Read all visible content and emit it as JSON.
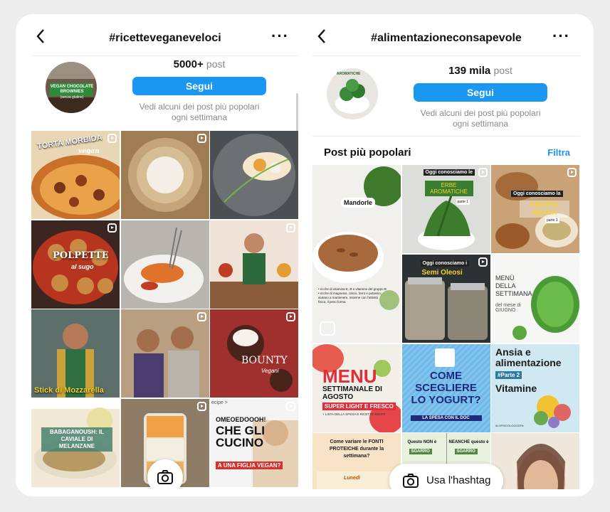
{
  "left": {
    "title": "#ricetteveganeveloci",
    "post_count": "5000+",
    "post_label": "post",
    "follow_label": "Segui",
    "hint_line1": "Vedi alcuni dei post più popolari",
    "hint_line2": "ogni settimana",
    "avatar_text1": "VEGAN CHOCOLATE BROWNIES",
    "avatar_text2": "(senza glutine)",
    "tiles": [
      {
        "caption": "TORTA MORBIDA",
        "caption2": "vegan"
      },
      {
        "caption": ""
      },
      {
        "caption": ""
      },
      {
        "caption": "POLPETTE",
        "caption2": "al sugo"
      },
      {
        "caption": ""
      },
      {
        "caption": ""
      },
      {
        "caption": "Stick di Mozzarella"
      },
      {
        "caption": ""
      },
      {
        "caption": "BOUNTY",
        "caption2": "Vegani"
      },
      {
        "caption": "BABAGANOUSH: IL CAVIALE DI MELANZANE"
      },
      {
        "caption": ""
      },
      {
        "caption": "OMEOEDOOOH!",
        "caption2": "CHE GLI CUCINO",
        "caption3": "A UNA FIGLIA VEGAN?",
        "top": "ecipe >"
      }
    ]
  },
  "right": {
    "title": "#alimentazioneconsapevole",
    "post_count": "139 mila",
    "post_label": "post",
    "follow_label": "Segui",
    "hint_line1": "Vedi alcuni dei post più popolari",
    "hint_line2": "ogni settimana",
    "section_title": "Post più popolari",
    "filter_label": "Filtra",
    "hashtag_button": "Usa l'hashtag",
    "tiles": [
      {
        "caption": "Mandorle",
        "small": "• ricche di vitamina E, B e vitamine del gruppo B • ricche di magnesio, calcio, ferro e potassio; aiutano a mantenere, insieme con l'attività fisica, il peso forma"
      },
      {
        "caption": "Oggi conosciamo le",
        "caption2": "ERBE AROMATICHE",
        "tag": "parte 1"
      },
      {
        "caption": "Oggi conosciamo la",
        "caption2": "FRUTTA SECCA",
        "tag": "parte 1"
      },
      {
        "caption": "Oggi conosciamo i",
        "caption2": "Semi Oleosi"
      },
      {
        "caption": "MENÙ DELLA SETTIMANA",
        "caption2": "del mese di GIUGNO"
      },
      {
        "caption": "MENU",
        "caption2": "SETTIMANALE DI AGOSTO",
        "caption3": "SUPER LIGHT E FRESCO",
        "caption4": "+ LISTA DELLA SPESA E RICETTE SMART"
      },
      {
        "caption": "COME SCEGLIERE LO YOGURT?",
        "caption2": "LA SPESA CON IL DOC"
      },
      {
        "caption": "Ansia e alimentazione",
        "caption2": "#Parte 2",
        "caption3": "Vitamine",
        "caption4": "#LOPSICOLOGOZEN"
      },
      {
        "caption": "Come variare le FONTI PROTEICHE durante la settimana?",
        "caption2": "Lunedì"
      },
      {
        "caption": "Questo NON è",
        "caption2": "SGARRO",
        "caption3": "NEANCHE questo è",
        "caption4": "SGARRO"
      },
      {
        "caption": ""
      }
    ]
  },
  "colors": {
    "accent": "#1a97f1",
    "background": "#ededed"
  },
  "icons": [
    "back-arrow-icon",
    "more-dots-icon",
    "reel-icon",
    "camera-icon"
  ]
}
